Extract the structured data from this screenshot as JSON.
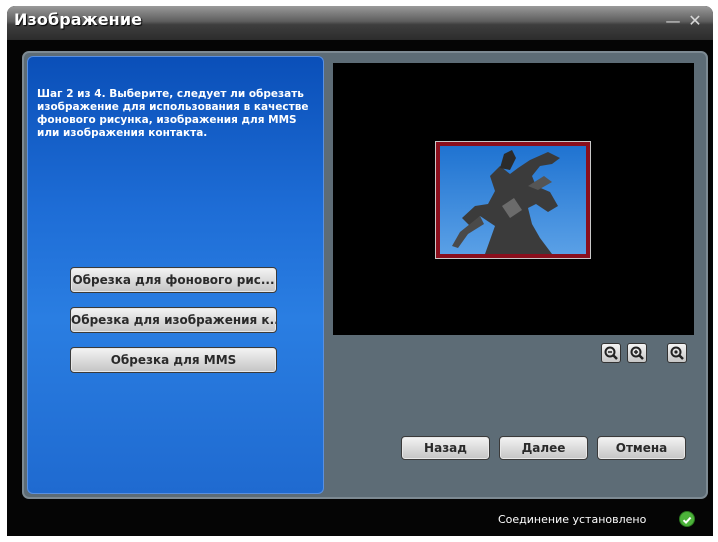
{
  "window": {
    "title": "Изображение",
    "minimize_symbol": "—",
    "close_symbol": "✕"
  },
  "left_panel": {
    "step_text": "Шаг 2 из 4. Выберите, следует ли обрезать изображение для использования в качестве фонового рисунка, изображения для MMS или изображения контакта.",
    "buttons": [
      {
        "label": "Обрезка для фонового рис..."
      },
      {
        "label": "Обрезка для изображения к..."
      },
      {
        "label": "Обрезка для MMS"
      }
    ]
  },
  "preview": {
    "zoom_icons": [
      "zoom-out-icon",
      "zoom-in-icon",
      "zoom-fit-icon"
    ]
  },
  "nav": {
    "back_label": "Назад",
    "next_label": "Далее",
    "cancel_label": "Отмена"
  },
  "status": {
    "text": "Соединение установлено",
    "icon": "check-circle-icon",
    "color": "#4cb23a"
  },
  "colors": {
    "panel_blue": "#1e6dd6",
    "photo_border": "#8a0f1d"
  }
}
